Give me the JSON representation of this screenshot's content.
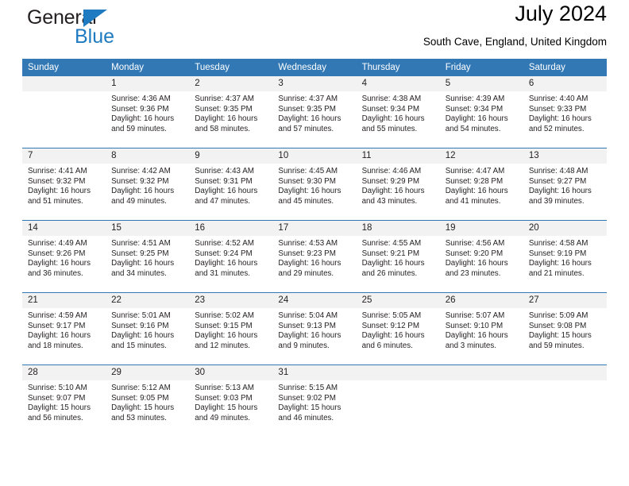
{
  "brand": {
    "name_dark": "General",
    "name_blue": "Blue",
    "accent_color": "#1f7bc1"
  },
  "header": {
    "title": "July 2024",
    "location": "South Cave, England, United Kingdom",
    "header_bg": "#3278b5",
    "datenum_bg": "#f2f2f2"
  },
  "weekday_headers": [
    "Sunday",
    "Monday",
    "Tuesday",
    "Wednesday",
    "Thursday",
    "Friday",
    "Saturday"
  ],
  "labels": {
    "sunrise_prefix": "Sunrise:",
    "sunset_prefix": "Sunset:",
    "daylight_prefix": "Daylight:"
  },
  "weeks": [
    [
      {
        "day": "",
        "line1": "",
        "line2": "",
        "line3": "",
        "line4": ""
      },
      {
        "day": "1",
        "line1": "Sunrise: 4:36 AM",
        "line2": "Sunset: 9:36 PM",
        "line3": "Daylight: 16 hours",
        "line4": "and 59 minutes."
      },
      {
        "day": "2",
        "line1": "Sunrise: 4:37 AM",
        "line2": "Sunset: 9:35 PM",
        "line3": "Daylight: 16 hours",
        "line4": "and 58 minutes."
      },
      {
        "day": "3",
        "line1": "Sunrise: 4:37 AM",
        "line2": "Sunset: 9:35 PM",
        "line3": "Daylight: 16 hours",
        "line4": "and 57 minutes."
      },
      {
        "day": "4",
        "line1": "Sunrise: 4:38 AM",
        "line2": "Sunset: 9:34 PM",
        "line3": "Daylight: 16 hours",
        "line4": "and 55 minutes."
      },
      {
        "day": "5",
        "line1": "Sunrise: 4:39 AM",
        "line2": "Sunset: 9:34 PM",
        "line3": "Daylight: 16 hours",
        "line4": "and 54 minutes."
      },
      {
        "day": "6",
        "line1": "Sunrise: 4:40 AM",
        "line2": "Sunset: 9:33 PM",
        "line3": "Daylight: 16 hours",
        "line4": "and 52 minutes."
      }
    ],
    [
      {
        "day": "7",
        "line1": "Sunrise: 4:41 AM",
        "line2": "Sunset: 9:32 PM",
        "line3": "Daylight: 16 hours",
        "line4": "and 51 minutes."
      },
      {
        "day": "8",
        "line1": "Sunrise: 4:42 AM",
        "line2": "Sunset: 9:32 PM",
        "line3": "Daylight: 16 hours",
        "line4": "and 49 minutes."
      },
      {
        "day": "9",
        "line1": "Sunrise: 4:43 AM",
        "line2": "Sunset: 9:31 PM",
        "line3": "Daylight: 16 hours",
        "line4": "and 47 minutes."
      },
      {
        "day": "10",
        "line1": "Sunrise: 4:45 AM",
        "line2": "Sunset: 9:30 PM",
        "line3": "Daylight: 16 hours",
        "line4": "and 45 minutes."
      },
      {
        "day": "11",
        "line1": "Sunrise: 4:46 AM",
        "line2": "Sunset: 9:29 PM",
        "line3": "Daylight: 16 hours",
        "line4": "and 43 minutes."
      },
      {
        "day": "12",
        "line1": "Sunrise: 4:47 AM",
        "line2": "Sunset: 9:28 PM",
        "line3": "Daylight: 16 hours",
        "line4": "and 41 minutes."
      },
      {
        "day": "13",
        "line1": "Sunrise: 4:48 AM",
        "line2": "Sunset: 9:27 PM",
        "line3": "Daylight: 16 hours",
        "line4": "and 39 minutes."
      }
    ],
    [
      {
        "day": "14",
        "line1": "Sunrise: 4:49 AM",
        "line2": "Sunset: 9:26 PM",
        "line3": "Daylight: 16 hours",
        "line4": "and 36 minutes."
      },
      {
        "day": "15",
        "line1": "Sunrise: 4:51 AM",
        "line2": "Sunset: 9:25 PM",
        "line3": "Daylight: 16 hours",
        "line4": "and 34 minutes."
      },
      {
        "day": "16",
        "line1": "Sunrise: 4:52 AM",
        "line2": "Sunset: 9:24 PM",
        "line3": "Daylight: 16 hours",
        "line4": "and 31 minutes."
      },
      {
        "day": "17",
        "line1": "Sunrise: 4:53 AM",
        "line2": "Sunset: 9:23 PM",
        "line3": "Daylight: 16 hours",
        "line4": "and 29 minutes."
      },
      {
        "day": "18",
        "line1": "Sunrise: 4:55 AM",
        "line2": "Sunset: 9:21 PM",
        "line3": "Daylight: 16 hours",
        "line4": "and 26 minutes."
      },
      {
        "day": "19",
        "line1": "Sunrise: 4:56 AM",
        "line2": "Sunset: 9:20 PM",
        "line3": "Daylight: 16 hours",
        "line4": "and 23 minutes."
      },
      {
        "day": "20",
        "line1": "Sunrise: 4:58 AM",
        "line2": "Sunset: 9:19 PM",
        "line3": "Daylight: 16 hours",
        "line4": "and 21 minutes."
      }
    ],
    [
      {
        "day": "21",
        "line1": "Sunrise: 4:59 AM",
        "line2": "Sunset: 9:17 PM",
        "line3": "Daylight: 16 hours",
        "line4": "and 18 minutes."
      },
      {
        "day": "22",
        "line1": "Sunrise: 5:01 AM",
        "line2": "Sunset: 9:16 PM",
        "line3": "Daylight: 16 hours",
        "line4": "and 15 minutes."
      },
      {
        "day": "23",
        "line1": "Sunrise: 5:02 AM",
        "line2": "Sunset: 9:15 PM",
        "line3": "Daylight: 16 hours",
        "line4": "and 12 minutes."
      },
      {
        "day": "24",
        "line1": "Sunrise: 5:04 AM",
        "line2": "Sunset: 9:13 PM",
        "line3": "Daylight: 16 hours",
        "line4": "and 9 minutes."
      },
      {
        "day": "25",
        "line1": "Sunrise: 5:05 AM",
        "line2": "Sunset: 9:12 PM",
        "line3": "Daylight: 16 hours",
        "line4": "and 6 minutes."
      },
      {
        "day": "26",
        "line1": "Sunrise: 5:07 AM",
        "line2": "Sunset: 9:10 PM",
        "line3": "Daylight: 16 hours",
        "line4": "and 3 minutes."
      },
      {
        "day": "27",
        "line1": "Sunrise: 5:09 AM",
        "line2": "Sunset: 9:08 PM",
        "line3": "Daylight: 15 hours",
        "line4": "and 59 minutes."
      }
    ],
    [
      {
        "day": "28",
        "line1": "Sunrise: 5:10 AM",
        "line2": "Sunset: 9:07 PM",
        "line3": "Daylight: 15 hours",
        "line4": "and 56 minutes."
      },
      {
        "day": "29",
        "line1": "Sunrise: 5:12 AM",
        "line2": "Sunset: 9:05 PM",
        "line3": "Daylight: 15 hours",
        "line4": "and 53 minutes."
      },
      {
        "day": "30",
        "line1": "Sunrise: 5:13 AM",
        "line2": "Sunset: 9:03 PM",
        "line3": "Daylight: 15 hours",
        "line4": "and 49 minutes."
      },
      {
        "day": "31",
        "line1": "Sunrise: 5:15 AM",
        "line2": "Sunset: 9:02 PM",
        "line3": "Daylight: 15 hours",
        "line4": "and 46 minutes."
      },
      {
        "day": "",
        "line1": "",
        "line2": "",
        "line3": "",
        "line4": ""
      },
      {
        "day": "",
        "line1": "",
        "line2": "",
        "line3": "",
        "line4": ""
      },
      {
        "day": "",
        "line1": "",
        "line2": "",
        "line3": "",
        "line4": ""
      }
    ]
  ]
}
